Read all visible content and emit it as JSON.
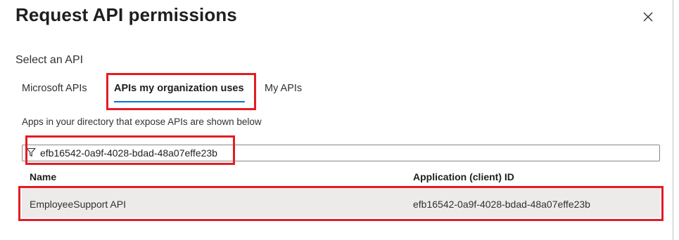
{
  "dialog": {
    "title": "Request API permissions",
    "close_icon": "close-icon"
  },
  "section": {
    "label": "Select an API"
  },
  "tabs": [
    {
      "label": "Microsoft APIs",
      "selected": false
    },
    {
      "label": "APIs my organization uses",
      "selected": true
    },
    {
      "label": "My APIs",
      "selected": false
    }
  ],
  "helper_text": "Apps in your directory that expose APIs are shown below",
  "filter": {
    "icon": "filter-icon",
    "value": "efb16542-0a9f-4028-bdad-48a07effe23b",
    "placeholder": ""
  },
  "table": {
    "columns": [
      "Name",
      "Application (client) ID"
    ],
    "rows": [
      {
        "name": "EmployeeSupport API",
        "app_id": "efb16542-0a9f-4028-bdad-48a07effe23b"
      }
    ]
  },
  "colors": {
    "accent": "#0078d4",
    "highlight": "#e31c24",
    "row_selected_bg": "#edebe9"
  }
}
